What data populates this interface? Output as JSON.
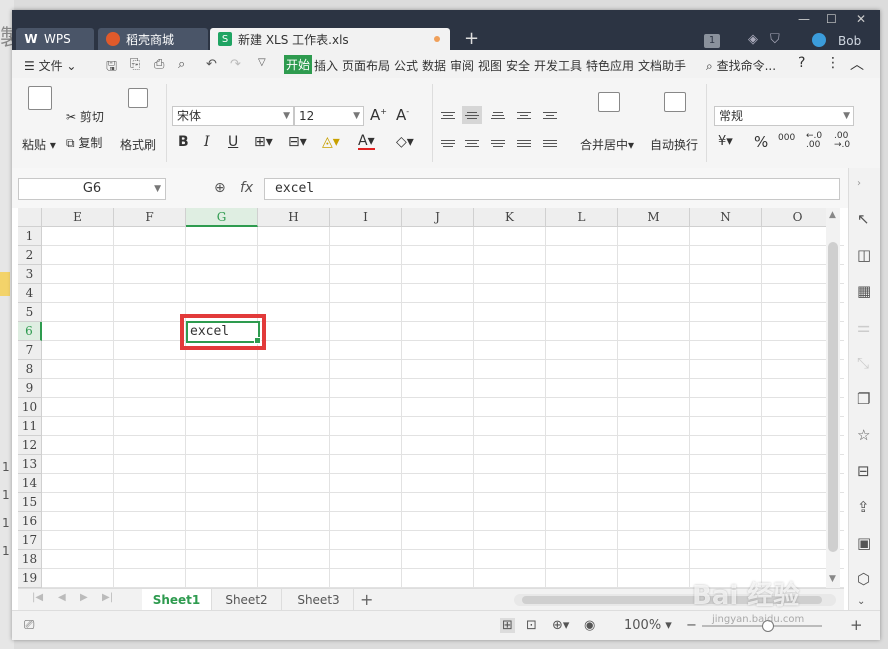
{
  "titlebar": {
    "tabs": [
      {
        "label": "WPS"
      },
      {
        "label": "稻壳商城"
      },
      {
        "label": "新建 XLS 工作表.xls"
      }
    ],
    "badge": "1",
    "user": "Bob"
  },
  "menu": {
    "file": "文件",
    "items": [
      "开始",
      "插入",
      "页面布局",
      "公式",
      "数据",
      "审阅",
      "视图",
      "安全",
      "开发工具",
      "特色应用",
      "文档助手"
    ],
    "search": "查找命令...",
    "help": "?"
  },
  "ribbon": {
    "paste": "粘贴",
    "cut": "剪切",
    "copy": "复制",
    "format_painter": "格式刷",
    "font_name": "宋体",
    "font_size": "12",
    "merge_center": "合并居中",
    "wrap_text": "自动换行",
    "number_format": "常规",
    "percent": "%",
    "thousands": "000"
  },
  "formula_bar": {
    "cell_ref": "G6",
    "fx": "fx",
    "content": "excel"
  },
  "grid": {
    "columns": [
      "E",
      "F",
      "G",
      "H",
      "I",
      "J",
      "K",
      "L",
      "M",
      "N",
      "O"
    ],
    "selected_column": "G",
    "rows": [
      "1",
      "2",
      "3",
      "4",
      "5",
      "6",
      "7",
      "8",
      "9",
      "10",
      "11",
      "12",
      "13",
      "14",
      "15",
      "16",
      "17",
      "18",
      "19"
    ],
    "selected_row": "6",
    "active_cell_value": "excel"
  },
  "sheets": {
    "tabs": [
      "Sheet1",
      "Sheet2",
      "Sheet3"
    ],
    "active": "Sheet1"
  },
  "status": {
    "zoom": "100%"
  },
  "watermark": {
    "text": "Bai 经验",
    "url": "jingyan.baidu.com"
  },
  "colors": {
    "accent": "#2e9b4f",
    "highlight": "#e23a3a",
    "titlebar": "#2c3443"
  }
}
